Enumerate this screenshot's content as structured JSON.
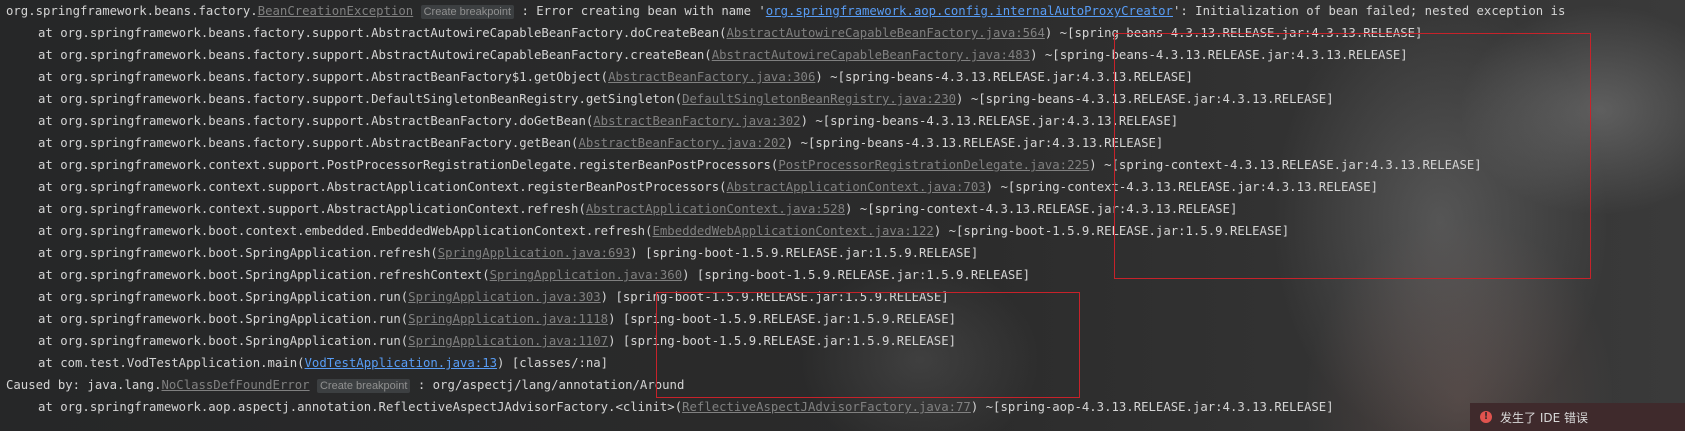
{
  "console": {
    "header": {
      "prefix": "org.springframework.beans.factory.",
      "exception_link": "BeanCreationException",
      "breakpoint_label": "Create breakpoint",
      "message_start": " : Error creating bean with name '",
      "bean_name": "org.springframework.aop.config.internalAutoProxyCreator",
      "message_end": "': Initialization of bean failed; nested exception is"
    },
    "frames": [
      {
        "method": "at org.springframework.beans.factory.support.AbstractAutowireCapableBeanFactory.doCreateBean(",
        "source": "AbstractAutowireCapableBeanFactory.java:564",
        "jar": ") ~[spring-beans-4.3.13.RELEASE.jar:4.3.13.RELEASE]"
      },
      {
        "method": "at org.springframework.beans.factory.support.AbstractAutowireCapableBeanFactory.createBean(",
        "source": "AbstractAutowireCapableBeanFactory.java:483",
        "jar": ") ~[spring-beans-4.3.13.RELEASE.jar:4.3.13.RELEASE]"
      },
      {
        "method": "at org.springframework.beans.factory.support.AbstractBeanFactory$1.getObject(",
        "source": "AbstractBeanFactory.java:306",
        "jar": ") ~[spring-beans-4.3.13.RELEASE.jar:4.3.13.RELEASE]"
      },
      {
        "method": "at org.springframework.beans.factory.support.DefaultSingletonBeanRegistry.getSingleton(",
        "source": "DefaultSingletonBeanRegistry.java:230",
        "jar": ") ~[spring-beans-4.3.13.RELEASE.jar:4.3.13.RELEASE]"
      },
      {
        "method": "at org.springframework.beans.factory.support.AbstractBeanFactory.doGetBean(",
        "source": "AbstractBeanFactory.java:302",
        "jar": ") ~[spring-beans-4.3.13.RELEASE.jar:4.3.13.RELEASE]"
      },
      {
        "method": "at org.springframework.beans.factory.support.AbstractBeanFactory.getBean(",
        "source": "AbstractBeanFactory.java:202",
        "jar": ") ~[spring-beans-4.3.13.RELEASE.jar:4.3.13.RELEASE]"
      },
      {
        "method": "at org.springframework.context.support.PostProcessorRegistrationDelegate.registerBeanPostProcessors(",
        "source": "PostProcessorRegistrationDelegate.java:225",
        "jar": ") ~[spring-context-4.3.13.RELEASE.jar:4.3.13.RELEASE]"
      },
      {
        "method": "at org.springframework.context.support.AbstractApplicationContext.registerBeanPostProcessors(",
        "source": "AbstractApplicationContext.java:703",
        "jar": ") ~[spring-context-4.3.13.RELEASE.jar:4.3.13.RELEASE]"
      },
      {
        "method": "at org.springframework.context.support.AbstractApplicationContext.refresh(",
        "source": "AbstractApplicationContext.java:528",
        "jar": ") ~[spring-context-4.3.13.RELEASE.jar:4.3.13.RELEASE]"
      },
      {
        "method": "at org.springframework.boot.context.embedded.EmbeddedWebApplicationContext.refresh(",
        "source": "EmbeddedWebApplicationContext.java:122",
        "jar": ") ~[spring-boot-1.5.9.RELEASE.jar:1.5.9.RELEASE]"
      },
      {
        "method": "at org.springframework.boot.SpringApplication.refresh(",
        "source": "SpringApplication.java:693",
        "jar": ") [spring-boot-1.5.9.RELEASE.jar:1.5.9.RELEASE]"
      },
      {
        "method": "at org.springframework.boot.SpringApplication.refreshContext(",
        "source": "SpringApplication.java:360",
        "jar": ") [spring-boot-1.5.9.RELEASE.jar:1.5.9.RELEASE]"
      },
      {
        "method": "at org.springframework.boot.SpringApplication.run(",
        "source": "SpringApplication.java:303",
        "jar": ") [spring-boot-1.5.9.RELEASE.jar:1.5.9.RELEASE]"
      },
      {
        "method": "at org.springframework.boot.SpringApplication.run(",
        "source": "SpringApplication.java:1118",
        "jar": ") [spring-boot-1.5.9.RELEASE.jar:1.5.9.RELEASE]"
      },
      {
        "method": "at org.springframework.boot.SpringApplication.run(",
        "source": "SpringApplication.java:1107",
        "jar": ") [spring-boot-1.5.9.RELEASE.jar:1.5.9.RELEASE]"
      },
      {
        "method": "at com.test.VodTestApplication.main(",
        "source": "VodTestApplication.java:13",
        "jar": ") [classes/:na]"
      }
    ],
    "caused_by": {
      "prefix": "Caused by: java.lang.",
      "exception_link": "NoClassDefFoundError",
      "breakpoint_label": "Create breakpoint",
      "message": " : org/aspectj/lang/annotation/Around"
    },
    "last_frame": {
      "method": "at org.springframework.aop.aspectj.annotation.ReflectiveAspectJAdvisorFactory.<clinit>(",
      "source": "ReflectiveAspectJAdvisorFactory.java:77",
      "jar": ") ~[spring-aop-4.3.13.RELEASE.jar:4.3.13.RELEASE]"
    }
  },
  "notification": {
    "icon": "error-icon",
    "text": "发生了 IDE 错误"
  },
  "colors": {
    "console_text": "#d4d4d4",
    "link_gray": "#808080",
    "link_blue": "#589df6",
    "highlight_box": "#c7222a"
  }
}
